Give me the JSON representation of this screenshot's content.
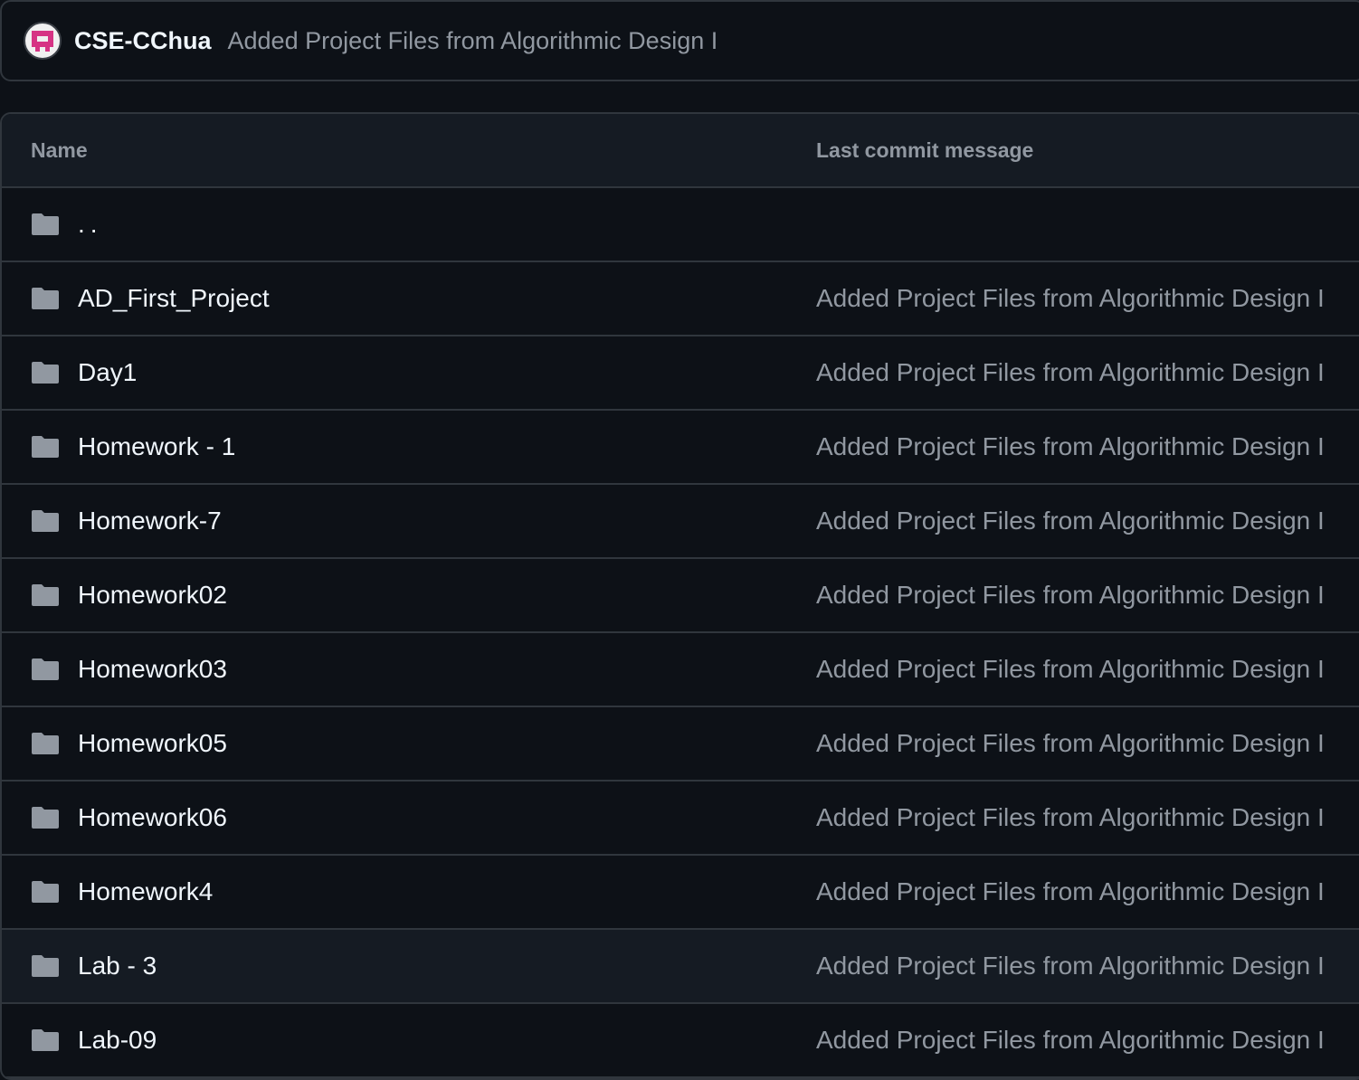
{
  "commit_bar": {
    "author": "CSE-CChua",
    "message": "Added Project Files from Algorithmic Design I"
  },
  "table": {
    "headers": {
      "name": "Name",
      "last_commit_message": "Last commit message"
    },
    "parent_dir": "..",
    "rows": [
      {
        "name": "AD_First_Project",
        "message": "Added Project Files from Algorithmic Design I"
      },
      {
        "name": "Day1",
        "message": "Added Project Files from Algorithmic Design I"
      },
      {
        "name": "Homework - 1",
        "message": "Added Project Files from Algorithmic Design I"
      },
      {
        "name": "Homework-7",
        "message": "Added Project Files from Algorithmic Design I"
      },
      {
        "name": "Homework02",
        "message": "Added Project Files from Algorithmic Design I"
      },
      {
        "name": "Homework03",
        "message": "Added Project Files from Algorithmic Design I"
      },
      {
        "name": "Homework05",
        "message": "Added Project Files from Algorithmic Design I"
      },
      {
        "name": "Homework06",
        "message": "Added Project Files from Algorithmic Design I"
      },
      {
        "name": "Homework4",
        "message": "Added Project Files from Algorithmic Design I"
      },
      {
        "name": "Lab - 3",
        "message": "Added Project Files from Algorithmic Design I"
      },
      {
        "name": "Lab-09",
        "message": "Added Project Files from Algorithmic Design I"
      }
    ]
  },
  "colors": {
    "background": "#0d1117",
    "header_bg": "#151b23",
    "border": "#30363d",
    "text_primary": "#f0f6fc",
    "text_muted": "#9198a1",
    "folder_icon": "#9198a1",
    "avatar_accent": "#d63384"
  },
  "icons": {
    "avatar": "identicon-avatar",
    "folder": "folder-icon"
  }
}
